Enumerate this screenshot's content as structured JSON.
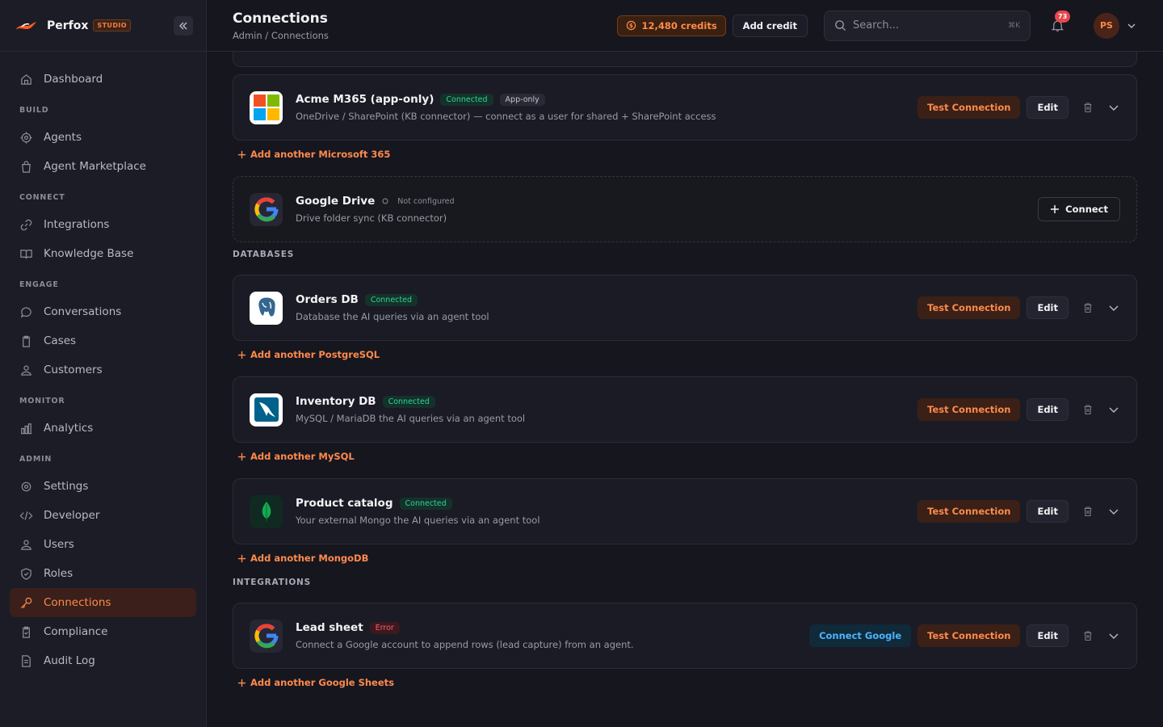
{
  "app": {
    "name": "Perfox",
    "badge": "STUDIO"
  },
  "header": {
    "title": "Connections",
    "breadcrumb": "Admin / Connections",
    "credits": "12,480 credits",
    "add_credit": "Add credit",
    "search_placeholder": "Search...",
    "search_shortcut": "⌘K",
    "notification_count": "73",
    "user_initials": "PS"
  },
  "sidebar": {
    "dashboard": "Dashboard",
    "sections": {
      "build": "BUILD",
      "connect": "CONNECT",
      "engage": "ENGAGE",
      "monitor": "MONITOR",
      "admin": "ADMIN"
    },
    "items": {
      "agents": "Agents",
      "marketplace": "Agent Marketplace",
      "integrations": "Integrations",
      "knowledge": "Knowledge Base",
      "conversations": "Conversations",
      "cases": "Cases",
      "customers": "Customers",
      "analytics": "Analytics",
      "settings": "Settings",
      "developer": "Developer",
      "users": "Users",
      "roles": "Roles",
      "connections": "Connections",
      "compliance": "Compliance",
      "audit": "Audit Log"
    },
    "active": "connections"
  },
  "actions": {
    "test": "Test Connection",
    "edit": "Edit",
    "connect": "Connect",
    "connect_google": "Connect Google"
  },
  "sections": {
    "databases": "DATABASES",
    "integrations": "INTEGRATIONS"
  },
  "connections": {
    "m365": {
      "title": "Acme M365 (app-only)",
      "status": "Connected",
      "tag": "App-only",
      "desc": "OneDrive / SharePoint (KB connector) — connect as a user for shared + SharePoint access",
      "add": "Add another Microsoft 365"
    },
    "gdrive": {
      "title": "Google Drive",
      "status": "Not configured",
      "desc": "Drive folder sync (KB connector)"
    },
    "orders": {
      "title": "Orders DB",
      "status": "Connected",
      "desc": "Database the AI queries via an agent tool",
      "add": "Add another PostgreSQL"
    },
    "inventory": {
      "title": "Inventory DB",
      "status": "Connected",
      "desc": "MySQL / MariaDB the AI queries via an agent tool",
      "add": "Add another MySQL"
    },
    "catalog": {
      "title": "Product catalog",
      "status": "Connected",
      "desc": "Your external Mongo the AI queries via an agent tool",
      "add": "Add another MongoDB"
    },
    "leads": {
      "title": "Lead sheet",
      "status": "Error",
      "desc": "Connect a Google account to append rows (lead capture) from an agent.",
      "add": "Add another Google Sheets"
    }
  },
  "colors": {
    "accent": "#ff8a4c",
    "connected": "#2fd39a",
    "error": "#ff5a6a",
    "google_action": "#4cb4ff"
  }
}
